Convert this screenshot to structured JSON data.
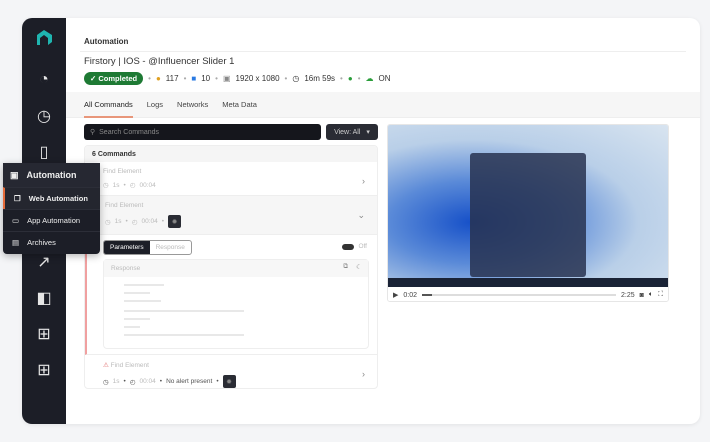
{
  "breadcrumb": "Automation",
  "test": {
    "title": "Firstory | IOS - @Influencer Slider 1",
    "status": "Completed",
    "browser_version": "117",
    "os_version": "10",
    "resolution": "1920 x 1080",
    "duration": "16m 59s",
    "tunnel": "ON"
  },
  "tabs": [
    "All Commands",
    "Logs",
    "Networks",
    "Meta Data"
  ],
  "search": {
    "placeholder": "Search Commands"
  },
  "view": {
    "label": "View: All"
  },
  "commands": {
    "count_label": "6 Commands",
    "items": [
      {
        "name": "Find Element",
        "wait": "1s",
        "time": "00:04"
      },
      {
        "name": "Find Element",
        "wait": "1s",
        "time": "00:04"
      },
      {
        "name": "Find Element",
        "wait": "1s",
        "time": "00:04",
        "note": "No alert present"
      }
    ]
  },
  "detail": {
    "tab_parameters": "Parameters",
    "tab_response": "Response",
    "toggle": "Off",
    "response_title": "Response"
  },
  "video": {
    "current": "0:02",
    "total": "2:25",
    "progress": 0.05
  },
  "menu": {
    "title": "Automation",
    "items": [
      "Web Automation",
      "App Automation",
      "Archives"
    ]
  },
  "colors": {
    "sidebar": "#1c1e27",
    "accent": "#e56b3a",
    "success": "#1e7a34",
    "logo": "#1fb5b0"
  }
}
